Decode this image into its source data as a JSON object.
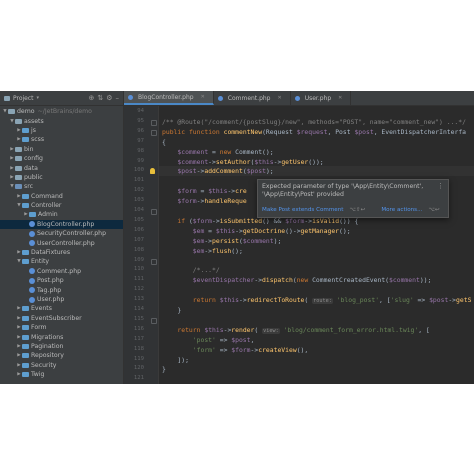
{
  "project": {
    "title": "Project",
    "root": "demo",
    "root_path": "~/JetBrains/demo",
    "tree": [
      {
        "label": "demo",
        "extra": "~/JetBrains/demo",
        "depth": 0,
        "type": "folder",
        "expanded": true
      },
      {
        "label": "assets",
        "depth": 1,
        "type": "folder",
        "expanded": true
      },
      {
        "label": "js",
        "depth": 2,
        "type": "folder",
        "expanded": false
      },
      {
        "label": "scss",
        "depth": 2,
        "type": "folder",
        "expanded": false
      },
      {
        "label": "bin",
        "depth": 1,
        "type": "folder",
        "expanded": false
      },
      {
        "label": "config",
        "depth": 1,
        "type": "folder",
        "expanded": false
      },
      {
        "label": "data",
        "depth": 1,
        "type": "folder",
        "expanded": false
      },
      {
        "label": "public",
        "depth": 1,
        "type": "folder",
        "expanded": false
      },
      {
        "label": "src",
        "depth": 1,
        "type": "src",
        "expanded": true
      },
      {
        "label": "Command",
        "depth": 2,
        "type": "folder",
        "expanded": false
      },
      {
        "label": "Controller",
        "depth": 2,
        "type": "folder",
        "expanded": true
      },
      {
        "label": "Admin",
        "depth": 3,
        "type": "folder",
        "expanded": false
      },
      {
        "label": "BlogController.php",
        "depth": 3,
        "type": "php",
        "selected": true
      },
      {
        "label": "SecurityController.php",
        "depth": 3,
        "type": "php"
      },
      {
        "label": "UserController.php",
        "depth": 3,
        "type": "php"
      },
      {
        "label": "DataFixtures",
        "depth": 2,
        "type": "folder",
        "expanded": false
      },
      {
        "label": "Entity",
        "depth": 2,
        "type": "folder",
        "expanded": true
      },
      {
        "label": "Comment.php",
        "depth": 3,
        "type": "php"
      },
      {
        "label": "Post.php",
        "depth": 3,
        "type": "php"
      },
      {
        "label": "Tag.php",
        "depth": 3,
        "type": "php"
      },
      {
        "label": "User.php",
        "depth": 3,
        "type": "php"
      },
      {
        "label": "Events",
        "depth": 2,
        "type": "folder",
        "expanded": false
      },
      {
        "label": "EventSubscriber",
        "depth": 2,
        "type": "folder",
        "expanded": false
      },
      {
        "label": "Form",
        "depth": 2,
        "type": "folder",
        "expanded": false
      },
      {
        "label": "Migrations",
        "depth": 2,
        "type": "folder",
        "expanded": false
      },
      {
        "label": "Pagination",
        "depth": 2,
        "type": "folder",
        "expanded": false
      },
      {
        "label": "Repository",
        "depth": 2,
        "type": "folder",
        "expanded": false
      },
      {
        "label": "Security",
        "depth": 2,
        "type": "folder",
        "expanded": false
      },
      {
        "label": "Twig",
        "depth": 2,
        "type": "folder",
        "expanded": false
      }
    ]
  },
  "tabs": [
    {
      "label": "BlogController.php",
      "active": true
    },
    {
      "label": "Comment.php",
      "active": false
    },
    {
      "label": "User.php",
      "active": false
    }
  ],
  "line_numbers": [
    "94",
    "95",
    "96",
    "97",
    "98",
    "99",
    "100",
    "101",
    "102",
    "103",
    "104",
    "105",
    "106",
    "107",
    "108",
    "109",
    "110",
    "111",
    "112",
    "113",
    "114",
    "115",
    "116",
    "117",
    "118",
    "119",
    "120",
    "121",
    "122",
    "123"
  ],
  "code_lines": [
    "",
    "/** @Route(\"/comment/{postSlug}/new\", methods=\"POST\", name=\"comment_new\") ...*/",
    "public function commentNew(Request $request, Post $post, EventDispatcherInterfa",
    "{",
    "    $comment = new Comment();",
    "    $comment->setAuthor($this->getUser());",
    "    $post->addComment($post);",
    "",
    "    $form = $this->cre",
    "    $form->handleReque",
    "",
    "    if ($form->isSubmitted() && $form->isValid()) {",
    "        $em = $this->getDoctrine()->getManager();",
    "        $em->persist($comment);",
    "        $em->flush();",
    "",
    "        /*...*/",
    "        $eventDispatcher->dispatch(new CommentCreatedEvent($comment));",
    "",
    "        return $this->redirectToRoute( route: 'blog_post', ['slug' => $post->getS",
    "    }",
    "",
    "    return $this->render( view: 'blog/comment_form_error.html.twig', [",
    "        'post' => $post,",
    "        'form' => $form->createView(),",
    "    ]);",
    "}",
    ""
  ],
  "popup": {
    "message": "Expected parameter of type '\\App\\Entity\\Comment', '\\App\\Entity\\Post' provided",
    "action_primary": "Make Post extends Comment",
    "action_primary_shortcut": "⌥⇧↩",
    "action_more": "More actions...",
    "action_more_shortcut": "⌥↩",
    "menu_icon": "vertical-dots-icon"
  },
  "colors": {
    "background": "#2b2b2b",
    "panel": "#3c3f41",
    "selection": "#0d293e",
    "keyword": "#cc7832",
    "function": "#ffc66d",
    "variable": "#9876aa",
    "string": "#6a8759",
    "link": "#5394ec"
  }
}
